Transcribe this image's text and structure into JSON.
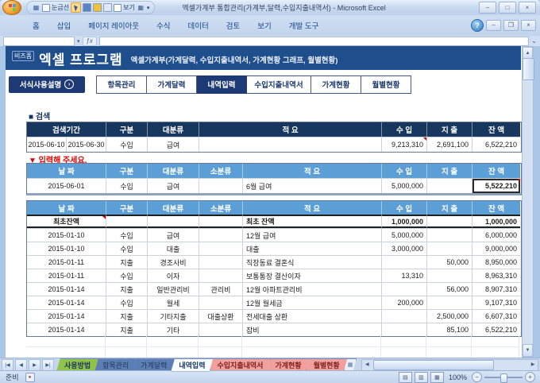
{
  "colors": {
    "header_band": "#1f4e8c",
    "accent_navy": "#1e3a74",
    "search_header": "#17375e",
    "table_header_blue": "#5b9fd6",
    "prompt_red": "#e00000",
    "tab_green": "#8fc449",
    "tab_pink": "#f2a09e"
  },
  "icons": {
    "minimize": "–",
    "maximize": "□",
    "restore": "❐",
    "close": "×",
    "help": "?",
    "up": "▲",
    "down": "▼",
    "left": "◀",
    "right": "▶",
    "first": "|◀",
    "last": "▶|",
    "dropdown": "▾",
    "chevron": "⌄",
    "fx": "ƒx",
    "grid": "▦",
    "insert_sheet": "▦",
    "view_normal": "▤",
    "view_layout": "▥",
    "view_break": "▦",
    "zoom_out": "−",
    "zoom_in": "+",
    "macro": "●",
    "guide_arrow": "›"
  },
  "titlebar": {
    "title": "엑셀가계부 통합관리(가계부,달력,수입지출내역서) - Microsoft Excel",
    "qat_gridlines": "눈금선",
    "qat_view": "보기"
  },
  "ribbon": {
    "tabs": [
      "홈",
      "삽입",
      "페이지 레이아웃",
      "수식",
      "데이터",
      "검토",
      "보기",
      "개발 도구"
    ]
  },
  "banner": {
    "logo": "비즈폼",
    "title": "엑셀 프로그램",
    "subtitle": "엑셀가계부(가계달력, 수입지출내역서, 가계현황 그래프, 월별현황)"
  },
  "nav": {
    "guide_button": "서식사용설명",
    "menu": [
      {
        "label": "항목관리",
        "active": false,
        "wide": false
      },
      {
        "label": "가계달력",
        "active": false,
        "wide": false
      },
      {
        "label": "내역입력",
        "active": true,
        "wide": false
      },
      {
        "label": "수입지출내역서",
        "active": false,
        "wide": true
      },
      {
        "label": "가계현황",
        "active": false,
        "wide": false
      },
      {
        "label": "월별현황",
        "active": false,
        "wide": false
      }
    ]
  },
  "search": {
    "label": "■ 검색",
    "headers": {
      "period": "검색기간",
      "type": "구분",
      "category": "대분류",
      "desc": "적 요",
      "income": "수 입",
      "expense": "지 출",
      "balance": "잔 액"
    },
    "row": {
      "from": "2015-06-10",
      "to": "2015-06-30",
      "type": "수입",
      "category": "급여",
      "desc": "",
      "income": "9,213,310",
      "expense": "2,691,100",
      "balance": "6,522,210"
    }
  },
  "entry": {
    "prompt": "▼ 입력해 주세요.",
    "headers": {
      "date": "날 짜",
      "type": "구분",
      "category": "대분류",
      "subcategory": "소분류",
      "desc": "적 요",
      "income": "수 입",
      "expense": "지 출",
      "balance": "잔 액"
    },
    "row": {
      "date": "2015-06-01",
      "type": "수입",
      "category": "급여",
      "subcategory": "",
      "desc": "6월 급여",
      "income": "5,000,000",
      "expense": "",
      "balance": "5,522,210"
    }
  },
  "ledger": {
    "headers": [
      "날 짜",
      "구분",
      "대분류",
      "소분류",
      "적 요",
      "수 입",
      "지 출",
      "잔 액"
    ],
    "rows": [
      [
        "최초잔액",
        "",
        "",
        "",
        "최초 잔액",
        "1,000,000",
        "",
        "1,000,000"
      ],
      [
        "2015-01-10",
        "수입",
        "급여",
        "",
        "12월 급여",
        "5,000,000",
        "",
        "6,000,000"
      ],
      [
        "2015-01-10",
        "수입",
        "대출",
        "",
        "대출",
        "3,000,000",
        "",
        "9,000,000"
      ],
      [
        "2015-01-11",
        "지출",
        "경조사비",
        "",
        "직장동료 결혼식",
        "",
        "50,000",
        "8,950,000"
      ],
      [
        "2015-01-11",
        "수입",
        "이자",
        "",
        "보통통장 결산이자",
        "13,310",
        "",
        "8,963,310"
      ],
      [
        "2015-01-14",
        "지출",
        "일반관리비",
        "관리비",
        "12월 아파트관리비",
        "",
        "56,000",
        "8,907,310"
      ],
      [
        "2015-01-14",
        "수입",
        "월세",
        "",
        "12월 월세금",
        "200,000",
        "",
        "9,107,310"
      ],
      [
        "2015-01-14",
        "지출",
        "기타지출",
        "대출상환",
        "전세대출 상환",
        "",
        "2,500,000",
        "6,607,310"
      ],
      [
        "2015-01-14",
        "지출",
        "기타",
        "",
        "잡비",
        "",
        "85,100",
        "6,522,210"
      ]
    ]
  },
  "sheets": {
    "tabs": [
      {
        "label": "사용방법",
        "style": "green"
      },
      {
        "label": "항목관리",
        "style": "blue"
      },
      {
        "label": "가계달력",
        "style": "blue"
      },
      {
        "label": "내역입력",
        "style": "active"
      },
      {
        "label": "수입지출내역서",
        "style": "pink"
      },
      {
        "label": "가계현황",
        "style": "pink"
      },
      {
        "label": "월별현황",
        "style": "pink"
      }
    ]
  },
  "status": {
    "ready": "준비",
    "zoom": "100%"
  }
}
